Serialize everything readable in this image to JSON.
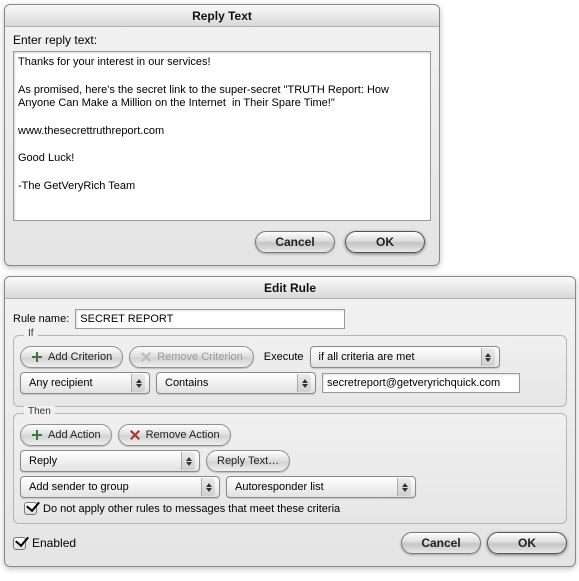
{
  "reply_dialog": {
    "title": "Reply Text",
    "prompt": "Enter reply text:",
    "body": "Thanks for your interest in our services!\n\nAs promised, here's the secret link to the super-secret \"TRUTH Report: How Anyone Can Make a Million on the Internet  in Their Spare Time!\"\n\nwww.thesecrettruthreport.com\n\nGood Luck!\n\n-The GetVeryRich Team",
    "cancel": "Cancel",
    "ok": "OK"
  },
  "edit_rule": {
    "title": "Edit Rule",
    "name_label": "Rule name:",
    "name_value": "SECRET REPORT",
    "if_legend": "If",
    "then_legend": "Then",
    "add_criterion": "Add Criterion",
    "remove_criterion": "Remove Criterion",
    "execute_label": "Execute",
    "execute_value": "if all criteria are met",
    "crit_field": "Any recipient",
    "crit_op": "Contains",
    "crit_value": "secretreport@getveryrichquick.com",
    "add_action": "Add Action",
    "remove_action": "Remove Action",
    "action1": "Reply",
    "reply_text_btn": "Reply Text…",
    "action2": "Add sender to group",
    "action2_target": "Autoresponder list",
    "stop_rules": "Do not apply other rules to messages that meet these criteria",
    "enabled": "Enabled",
    "cancel": "Cancel",
    "ok": "OK"
  }
}
